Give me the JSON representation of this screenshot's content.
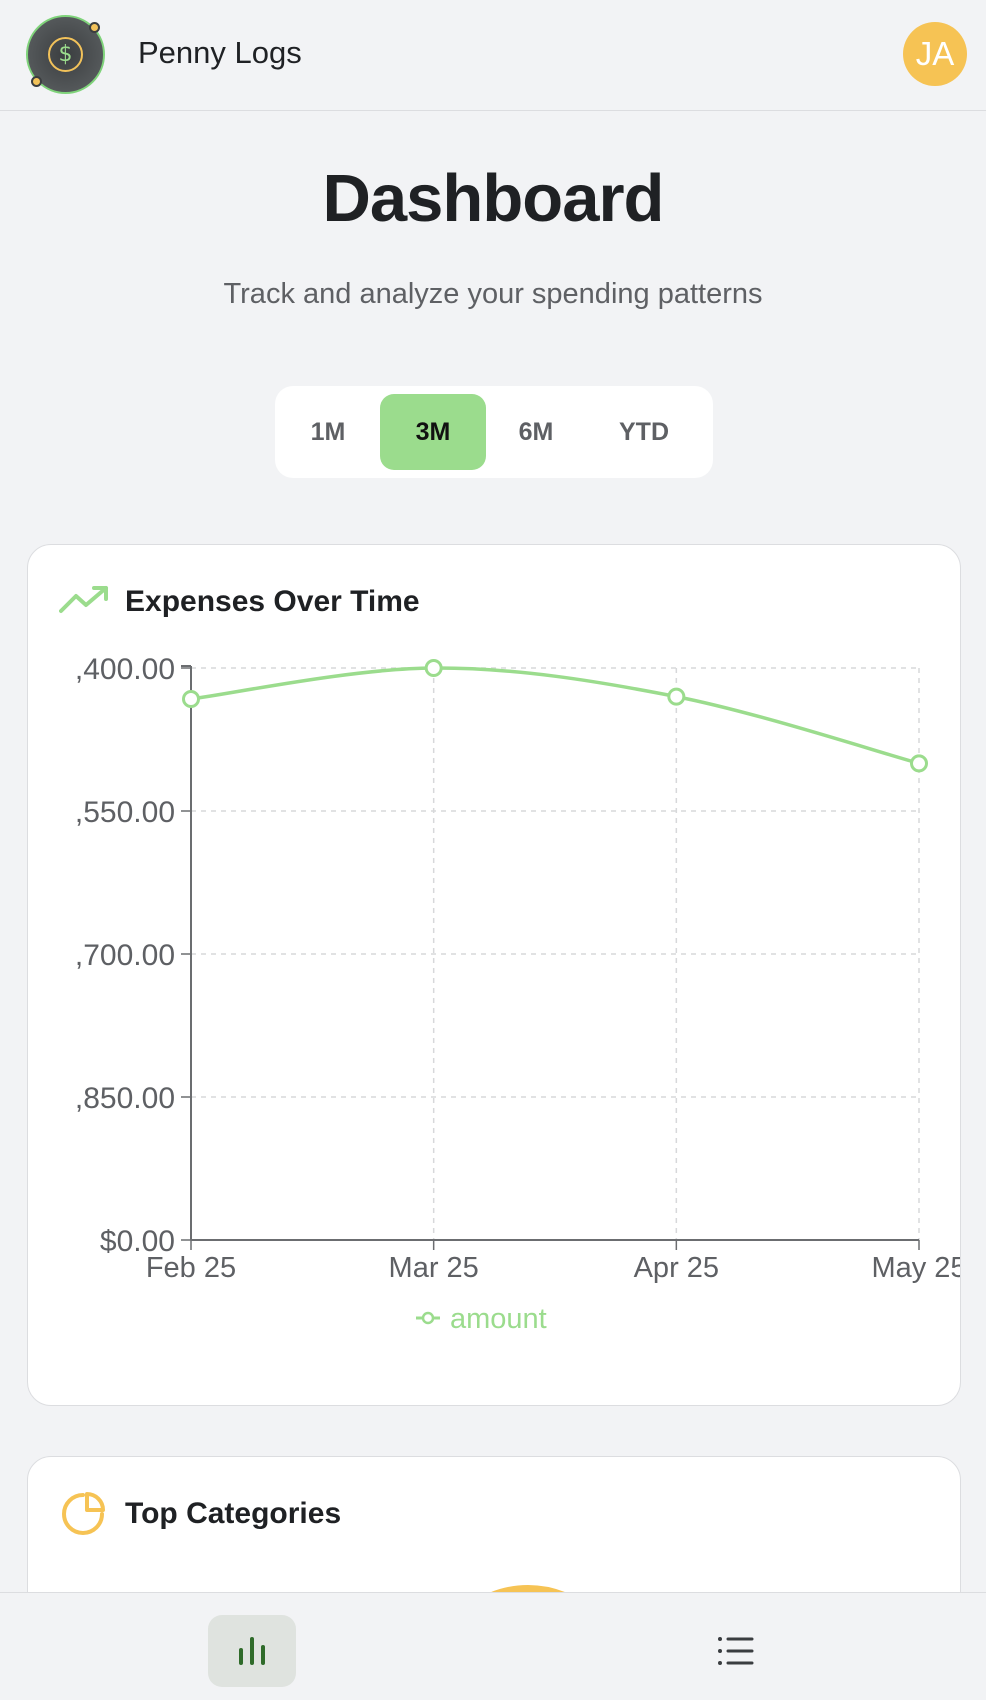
{
  "header": {
    "app_name": "Penny Logs",
    "logo_icon": "dollar-coin-icon",
    "avatar_initials": "JA"
  },
  "page": {
    "title": "Dashboard",
    "subtitle": "Track and analyze your spending patterns"
  },
  "range_selector": {
    "options": [
      "1M",
      "3M",
      "6M",
      "YTD"
    ],
    "selected": "3M"
  },
  "expenses_card": {
    "title": "Expenses Over Time",
    "icon": "trending-up-icon"
  },
  "categories_card": {
    "title": "Top Categories",
    "icon": "pie-chart-icon"
  },
  "bottom_nav": {
    "items": [
      {
        "icon": "bar-chart-icon",
        "active": true
      },
      {
        "icon": "list-icon",
        "active": false
      }
    ]
  },
  "colors": {
    "accent_green": "#9bdc8d",
    "accent_yellow": "#f6c354",
    "text_dark": "#1f2124",
    "text_muted": "#5e6064"
  },
  "chart_data": {
    "type": "line",
    "x": [
      "Feb 25",
      "Mar 25",
      "Apr 25",
      "May 25"
    ],
    "series": [
      {
        "name": "amount",
        "values": [
          2270,
          2400,
          2280,
          2000
        ]
      }
    ],
    "y_tick_labels": [
      ",400.00",
      ",550.00",
      ",700.00",
      ",850.00",
      "$0.00"
    ],
    "ylim": [
      0,
      2400
    ],
    "grid": true,
    "legend_placement": "bottom-center",
    "line_color": "#9bdc8d"
  }
}
